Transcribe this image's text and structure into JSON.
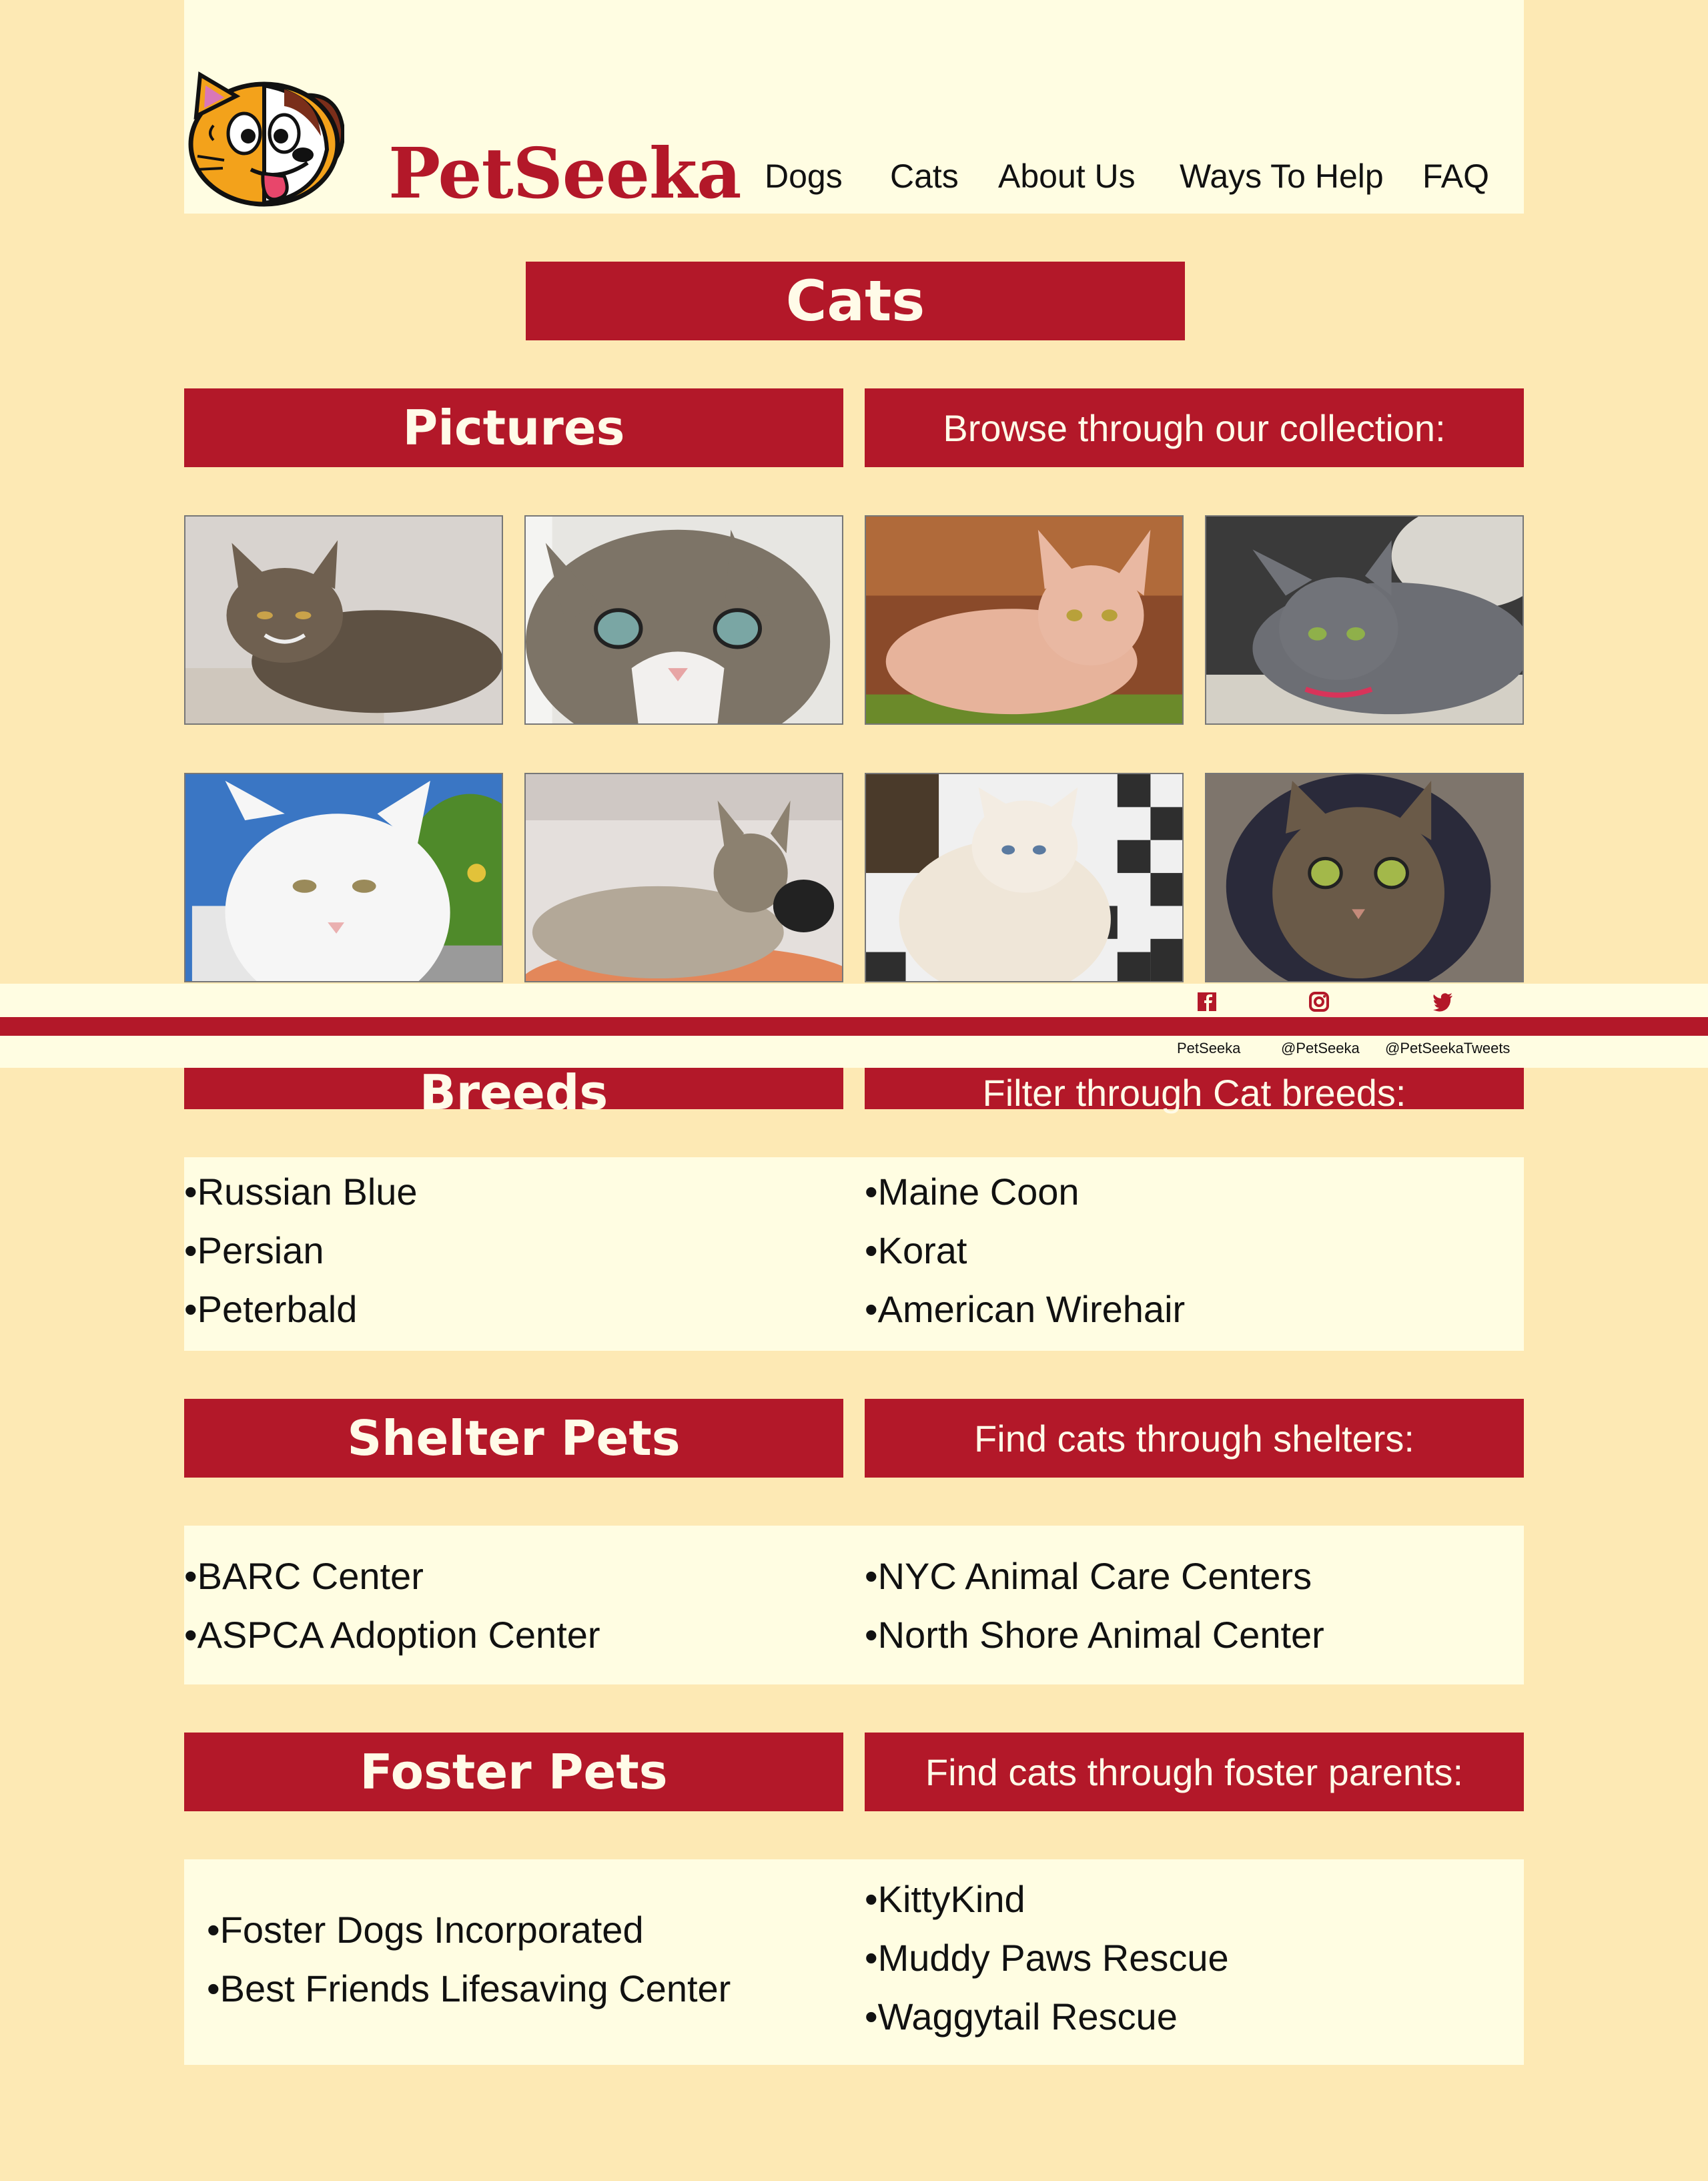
{
  "brand": {
    "name": "PetSeeka",
    "logo_icon": "cat-dog-mascot-icon"
  },
  "nav": [
    "Dogs",
    "Cats",
    "About Us",
    "Ways To Help",
    "FAQ"
  ],
  "page_title": "Cats",
  "colors": {
    "accent": "#b31829",
    "background": "#fde9b4",
    "panel": "#fffde2"
  },
  "pictures": {
    "heading": "Pictures",
    "subheading": "Browse through our collection:",
    "photos": [
      "tabby-longhair-cat-photo",
      "tabby-white-cat-photo",
      "sphynx-cat-photo",
      "russian-blue-cat-photo",
      "white-cat-photo",
      "maine-coon-cat-photo",
      "persian-cat-photo",
      "tabby-in-cat-tree-photo"
    ]
  },
  "breeds": {
    "heading": "Breeds",
    "subheading": "Filter through Cat breeds:",
    "left": [
      "Russian Blue",
      "Persian",
      "Peterbald"
    ],
    "right": [
      "Maine Coon",
      "Korat",
      "American Wirehair"
    ]
  },
  "shelter": {
    "heading": "Shelter Pets",
    "subheading": "Find cats through shelters:",
    "left": [
      "BARC Center",
      "ASPCA Adoption Center"
    ],
    "right": [
      "NYC Animal Care Centers",
      "North Shore Animal Center"
    ]
  },
  "foster": {
    "heading": "Foster Pets",
    "subheading": "Find cats through foster parents:",
    "left": [
      "Foster Dogs Incorporated",
      "Best Friends Lifesaving Center"
    ],
    "right": [
      "KittyKind",
      "Muddy Paws Rescue",
      "Waggytail Rescue"
    ]
  },
  "bullet": "•",
  "footer": {
    "social": [
      {
        "icon": "facebook-icon",
        "label": "PetSeeka"
      },
      {
        "icon": "instagram-icon",
        "label": "@PetSeeka"
      },
      {
        "icon": "twitter-icon",
        "label": "@PetSeekaTweets"
      }
    ]
  }
}
